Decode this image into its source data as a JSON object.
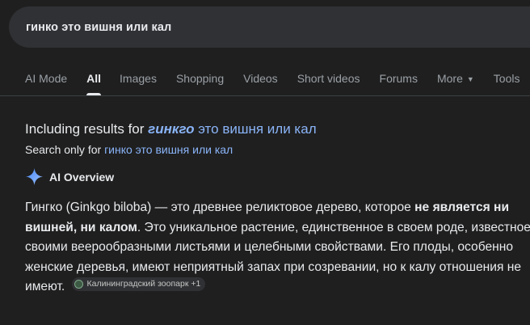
{
  "search": {
    "query": "гинко это вишня или кал"
  },
  "tabs": [
    {
      "label": "AI Mode"
    },
    {
      "label": "All"
    },
    {
      "label": "Images"
    },
    {
      "label": "Shopping"
    },
    {
      "label": "Videos"
    },
    {
      "label": "Short videos"
    },
    {
      "label": "Forums"
    },
    {
      "label": "More"
    },
    {
      "label": "Tools"
    }
  ],
  "spelling": {
    "including_prefix": "Including results for",
    "corrected_bold": "гинкго",
    "corrected_rest": " это вишня или кал",
    "search_only_prefix": "Search only for",
    "original_query": "гинко это вишня или кал"
  },
  "ai_overview": {
    "title": "AI Overview",
    "text_1": "Гингко (Ginkgo biloba) — это древнее реликтовое дерево, которое ",
    "text_bold": "не является ни вишней, ни калом",
    "text_2": ". Это уникальное растение, единственное в своем роде, известное своими веерообразными листьями и целебными свойствами. Его плоды, особенно женские деревья, имеют неприятный запах при созревании, но к калу отношения не имеют.",
    "source_chip": "Калининградский зоопарк +1",
    "sparkle_colors": [
      "#4285f4",
      "#9fc3ff"
    ]
  }
}
